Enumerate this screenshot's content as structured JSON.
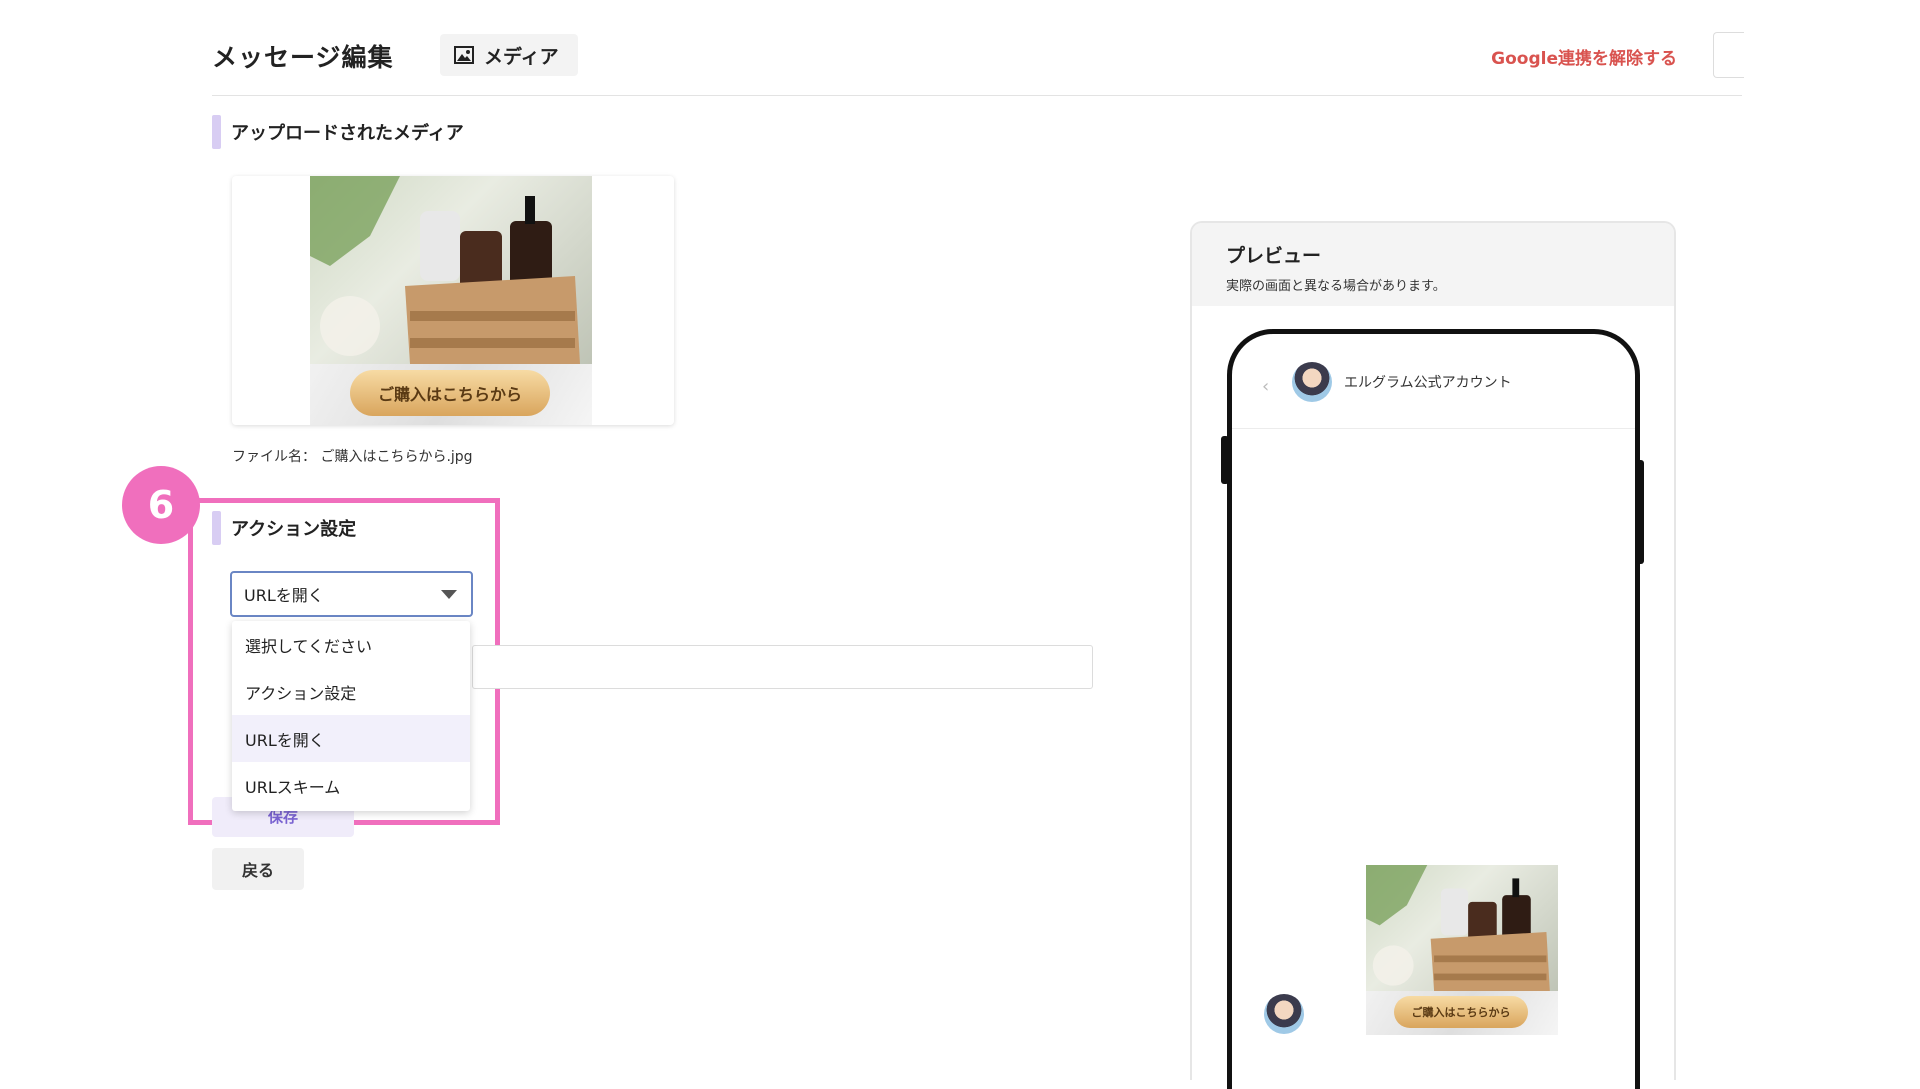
{
  "header": {
    "title": "メッセージ編集",
    "media_tab": "メディア",
    "google_link": "Google連携を解除する"
  },
  "uploaded": {
    "heading": "アップロードされたメディア",
    "image_button": "ご購入はこちらから",
    "file_label": "ファイル名：",
    "file_name": "ご購入はこちらから.jpg"
  },
  "step": {
    "number": "6"
  },
  "action": {
    "heading": "アクション設定",
    "selected": "URLを開く",
    "options": [
      "選択してください",
      "アクション設定",
      "URLを開く",
      "URLスキーム"
    ]
  },
  "buttons": {
    "save": "保存",
    "back": "戻る"
  },
  "preview": {
    "title": "プレビュー",
    "subtitle": "実際の画面と異なる場合があります。",
    "account_name": "エルグラム公式アカウント",
    "back_icon": "‹",
    "image_button": "ご購入はこちらから"
  },
  "colors": {
    "accent": "#f06fbd",
    "link": "#d9534f",
    "section_bar": "#d8cdf3"
  }
}
